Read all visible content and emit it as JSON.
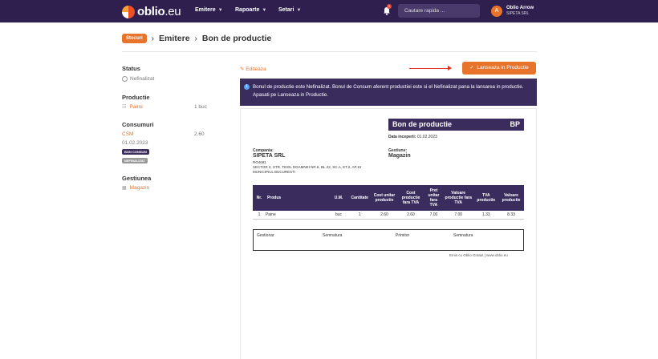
{
  "topbar": {
    "logo_text_bold": "oblio",
    "logo_text_light": ".eu",
    "nav": [
      {
        "label": "Emitere"
      },
      {
        "label": "Rapoarte"
      },
      {
        "label": "Setari"
      }
    ],
    "notification_count": "1",
    "search_placeholder": "Cautare rapida ...",
    "user_initial": "A",
    "user_name": "Oblio Arrow",
    "user_company": "SIPETA SRL"
  },
  "breadcrumb": {
    "badge": "Stocuri",
    "sep1": "›",
    "item1": "Emitere",
    "sep2": "›",
    "item2": "Bon de productie"
  },
  "sidebar": {
    "status_label": "Status",
    "status_value": "Nefinalizat",
    "productie_label": "Productie",
    "productie_item": "Paine",
    "productie_qty": "1 buc",
    "consumuri_label": "Consumuri",
    "consum_code": "CSM",
    "consum_value": "2.60",
    "consum_date": "01.02.2023",
    "tag_bon": "BON CONSUM",
    "tag_nef": "NEFINALIZAT",
    "gestiunea_label": "Gestiunea",
    "gestiunea_value": "Magazin"
  },
  "actions": {
    "edit_label": "Editeaza",
    "launch_label": "Lanseaza in Productie"
  },
  "info": {
    "text": "Bonul de productie este Nefinalizat. Bonul de Consum aferent productiei este si el Nefinalizat pana la lansarea in productie. Apasati pe Lanseaza in Productie."
  },
  "document": {
    "title": "Bon de productie",
    "code": "BP",
    "date_label": "Data inceperii:",
    "date_value": "01.02.2023",
    "company_label": "Compania:",
    "company_name": "SIPETA SRL",
    "company_id": "RO4681",
    "company_addr1": "SECTOR 2, STR. TEXIL DOAMNEI NR.6, BL.22, SC.A, ET.2, AP.10",
    "company_addr2": "MUNICIPIUL BUCURESTI",
    "gestiune_label": "Gestiune:",
    "gestiune_value": "Magazin",
    "columns": [
      "Nr.",
      "Produs",
      "U.M.",
      "Cantitate",
      "Cost unitar productie",
      "Cost productie fara TVA",
      "Pret unitar fara TVA",
      "Valoare productie fara TVA",
      "TVA productie",
      "Valoare productie"
    ],
    "rows": [
      [
        "1",
        "Paine",
        "buc",
        "1",
        "2.60",
        "2.60",
        "7.00",
        "7.00",
        "1.33",
        "8.33"
      ]
    ],
    "signatures": [
      "Gestionar",
      "Semnatura",
      "Primitor",
      "Semnatura"
    ],
    "footnote": "Emis cu Oblio Gratuit | www.oblio.eu"
  },
  "colors": {
    "brand_purple": "#2e1f4f",
    "accent_orange": "#e8732a",
    "arrow_red": "#e0342c"
  }
}
